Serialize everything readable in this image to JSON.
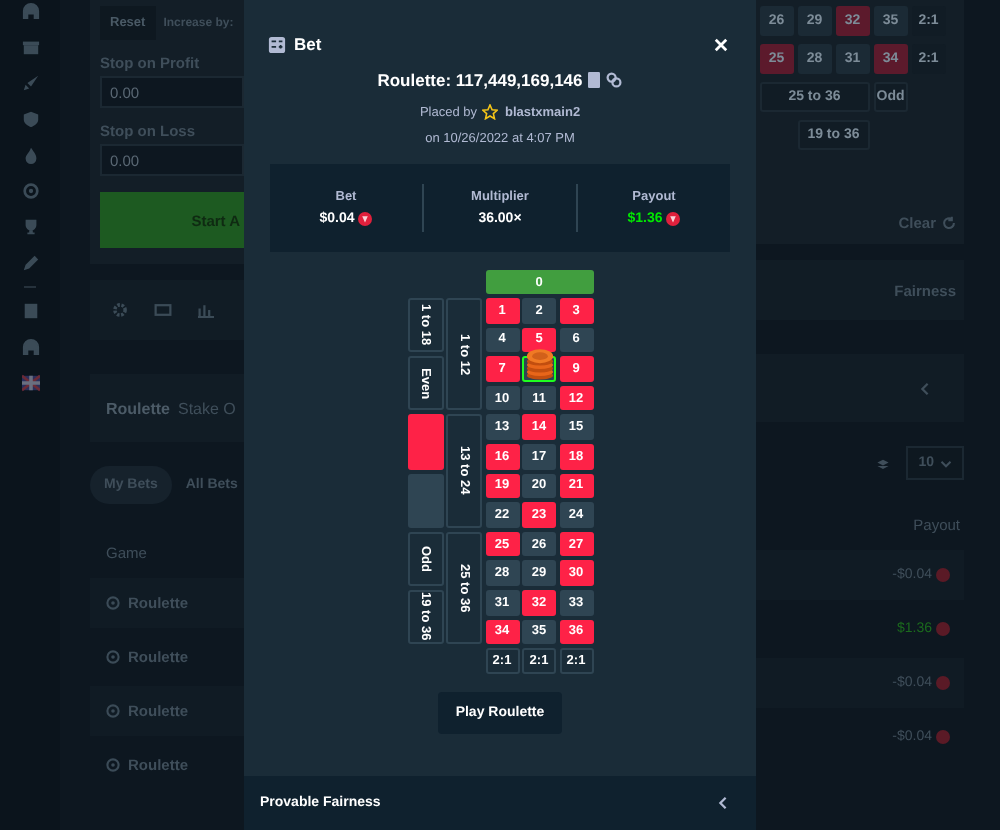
{
  "auto_controls": {
    "reset_button": "Reset",
    "increase_label": "Increase by:",
    "stop_on_profit": {
      "label": "Stop on Profit",
      "value": "0.00"
    },
    "stop_on_loss": {
      "label": "Stop on Loss",
      "value": "0.00"
    },
    "start_button": "Start A"
  },
  "game_info": {
    "title": "Roulette",
    "subtitle": "Stake O"
  },
  "bets_tabs": [
    {
      "label": "My Bets",
      "selected": true
    },
    {
      "label": "All Bets",
      "selected": false
    }
  ],
  "bets_table": {
    "columns": [
      "Game",
      "Payout"
    ],
    "rows": [
      {
        "game": "Roulette",
        "payout": "-$0.04",
        "win": false
      },
      {
        "game": "Roulette",
        "payout": "$1.36",
        "win": true
      },
      {
        "game": "Roulette",
        "payout": "-$0.04",
        "win": false
      },
      {
        "game": "Roulette",
        "payout": "-$0.04",
        "win": false
      }
    ]
  },
  "background_board": {
    "rows": [
      [
        {
          "label": "26",
          "color": "#1b2a35"
        },
        {
          "label": "29",
          "color": "#1b2a35"
        },
        {
          "label": "32",
          "color": "#5c1a2c"
        },
        {
          "label": "35",
          "color": "#1b2a35"
        },
        {
          "label": "2:1",
          "color": "#111c25"
        }
      ],
      [
        {
          "label": "25",
          "color": "#5c1a2c"
        },
        {
          "label": "28",
          "color": "#1b2a35"
        },
        {
          "label": "31",
          "color": "#1b2a35"
        },
        {
          "label": "34",
          "color": "#5c1a2c"
        },
        {
          "label": "2:1",
          "color": "#111c25"
        }
      ]
    ],
    "dozen": "25 to 36",
    "outside": [
      "Odd",
      "19 to 36"
    ],
    "clear_button": "Clear",
    "fairness_link": "Fairness",
    "page_size": "10"
  },
  "modal": {
    "title": "Bet",
    "game_id": "Roulette: 117,449,169,146",
    "placed_by": "Placed by",
    "user": "blastxmain2",
    "date": "on 10/26/2022 at 4:07 PM",
    "stats": [
      {
        "label": "Bet",
        "value": "$0.04",
        "kind": "currency",
        "win": false
      },
      {
        "label": "Multiplier",
        "value": "36.00×",
        "kind": "multiplier",
        "win": false
      },
      {
        "label": "Payout",
        "value": "$1.36",
        "kind": "currency",
        "win": true
      }
    ],
    "board": {
      "zero": "0",
      "numbers": [
        {
          "label": "1",
          "color": "#fe2247",
          "winning": false,
          "chip": false
        },
        {
          "label": "2",
          "color": "#2f4553",
          "winning": false,
          "chip": false
        },
        {
          "label": "3",
          "color": "#fe2247",
          "winning": false,
          "chip": false
        },
        {
          "label": "4",
          "color": "#2f4553",
          "winning": false,
          "chip": false
        },
        {
          "label": "5",
          "color": "#fe2247",
          "winning": false,
          "chip": false
        },
        {
          "label": "6",
          "color": "#2f4553",
          "winning": false,
          "chip": false
        },
        {
          "label": "7",
          "color": "#fe2247",
          "winning": false,
          "chip": false
        },
        {
          "color": "#2f4553",
          "winning": true,
          "chip": true
        },
        {
          "label": "9",
          "color": "#fe2247",
          "winning": false,
          "chip": false
        },
        {
          "label": "10",
          "color": "#2f4553",
          "winning": false,
          "chip": false
        },
        {
          "label": "11",
          "color": "#2f4553",
          "winning": false,
          "chip": false
        },
        {
          "label": "12",
          "color": "#fe2247",
          "winning": false,
          "chip": false
        },
        {
          "label": "13",
          "color": "#2f4553",
          "winning": false,
          "chip": false
        },
        {
          "label": "14",
          "color": "#fe2247",
          "winning": false,
          "chip": false
        },
        {
          "label": "15",
          "color": "#2f4553",
          "winning": false,
          "chip": false
        },
        {
          "label": "16",
          "color": "#fe2247",
          "winning": false,
          "chip": false
        },
        {
          "label": "17",
          "color": "#2f4553",
          "winning": false,
          "chip": false
        },
        {
          "label": "18",
          "color": "#fe2247",
          "winning": false,
          "chip": false
        },
        {
          "label": "19",
          "color": "#fe2247",
          "winning": false,
          "chip": false
        },
        {
          "label": "20",
          "color": "#2f4553",
          "winning": false,
          "chip": false
        },
        {
          "label": "21",
          "color": "#fe2247",
          "winning": false,
          "chip": false
        },
        {
          "label": "22",
          "color": "#2f4553",
          "winning": false,
          "chip": false
        },
        {
          "label": "23",
          "color": "#fe2247",
          "winning": false,
          "chip": false
        },
        {
          "label": "24",
          "color": "#2f4553",
          "winning": false,
          "chip": false
        },
        {
          "label": "25",
          "color": "#fe2247",
          "winning": false,
          "chip": false
        },
        {
          "label": "26",
          "color": "#2f4553",
          "winning": false,
          "chip": false
        },
        {
          "label": "27",
          "color": "#fe2247",
          "winning": false,
          "chip": false
        },
        {
          "label": "28",
          "color": "#2f4553",
          "winning": false,
          "chip": false
        },
        {
          "label": "29",
          "color": "#2f4553",
          "winning": false,
          "chip": false
        },
        {
          "label": "30",
          "color": "#fe2247",
          "winning": false,
          "chip": false
        },
        {
          "label": "31",
          "color": "#2f4553",
          "winning": false,
          "chip": false
        },
        {
          "label": "32",
          "color": "#fe2247",
          "winning": false,
          "chip": false
        },
        {
          "label": "33",
          "color": "#2f4553",
          "winning": false,
          "chip": false
        },
        {
          "label": "34",
          "color": "#fe2247",
          "winning": false,
          "chip": false
        },
        {
          "label": "35",
          "color": "#2f4553",
          "winning": false,
          "chip": false
        },
        {
          "label": "36",
          "color": "#fe2247",
          "winning": false,
          "chip": false
        }
      ],
      "dozens": [
        "1 to 12",
        "13 to 24",
        "25 to 36"
      ],
      "outside": [
        {
          "kind": "text",
          "label": "1 to 18"
        },
        {
          "kind": "text",
          "label": "Even"
        },
        {
          "kind": "swatch",
          "color": "#fe2247"
        },
        {
          "kind": "swatch",
          "color": "#2f4553"
        },
        {
          "kind": "text",
          "label": "Odd"
        },
        {
          "kind": "text",
          "label": "19 to 36"
        }
      ],
      "columns": [
        "2:1",
        "2:1",
        "2:1"
      ]
    },
    "play_button": "Play Roulette",
    "footer": "Provable Fairness"
  }
}
